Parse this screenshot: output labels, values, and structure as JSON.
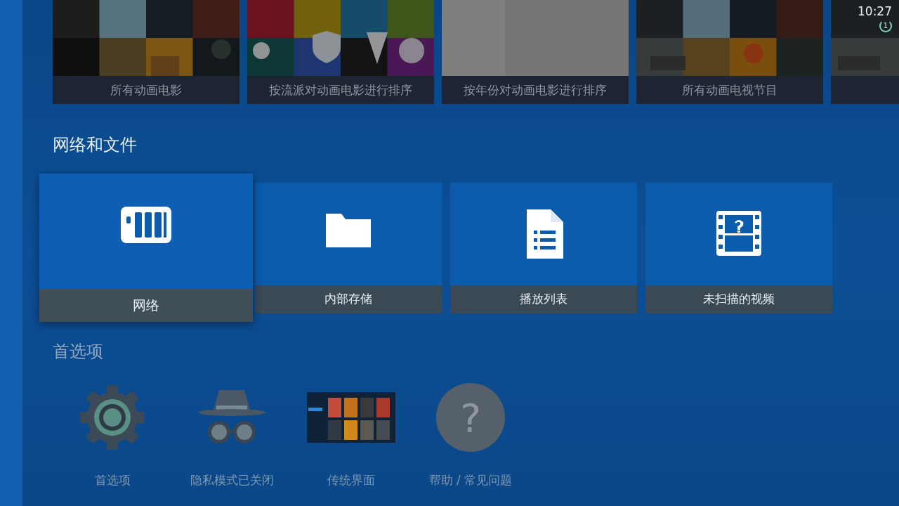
{
  "status": {
    "clock": "10:27",
    "busy_count": "1"
  },
  "top_row": [
    {
      "label": "所有动画电影",
      "kind": "picture"
    },
    {
      "label": "按流派对动画电影进行排序",
      "kind": "picture"
    },
    {
      "label": "按年份对动画电影进行排序",
      "kind": "picture"
    },
    {
      "label": "所有动画电视节目",
      "kind": "picture"
    },
    {
      "kind": "picture"
    }
  ],
  "network_section": {
    "title": "网络和文件",
    "items": [
      {
        "label": "网络",
        "kind": "nas",
        "selected": true
      },
      {
        "label": "内部存储",
        "kind": "folder",
        "selected": false
      },
      {
        "label": "播放列表",
        "kind": "document",
        "selected": false
      },
      {
        "label": "未扫描的视频",
        "kind": "film",
        "selected": false
      }
    ]
  },
  "preferences_section": {
    "title": "首选项",
    "items": [
      {
        "label": "首选项",
        "kind": "gear"
      },
      {
        "label": "隐私模式已关闭",
        "kind": "incognito"
      },
      {
        "label": "传统界面",
        "kind": "preview"
      },
      {
        "label": "帮助 / 常见问题",
        "kind": "help",
        "icon_text": "?"
      }
    ]
  }
}
